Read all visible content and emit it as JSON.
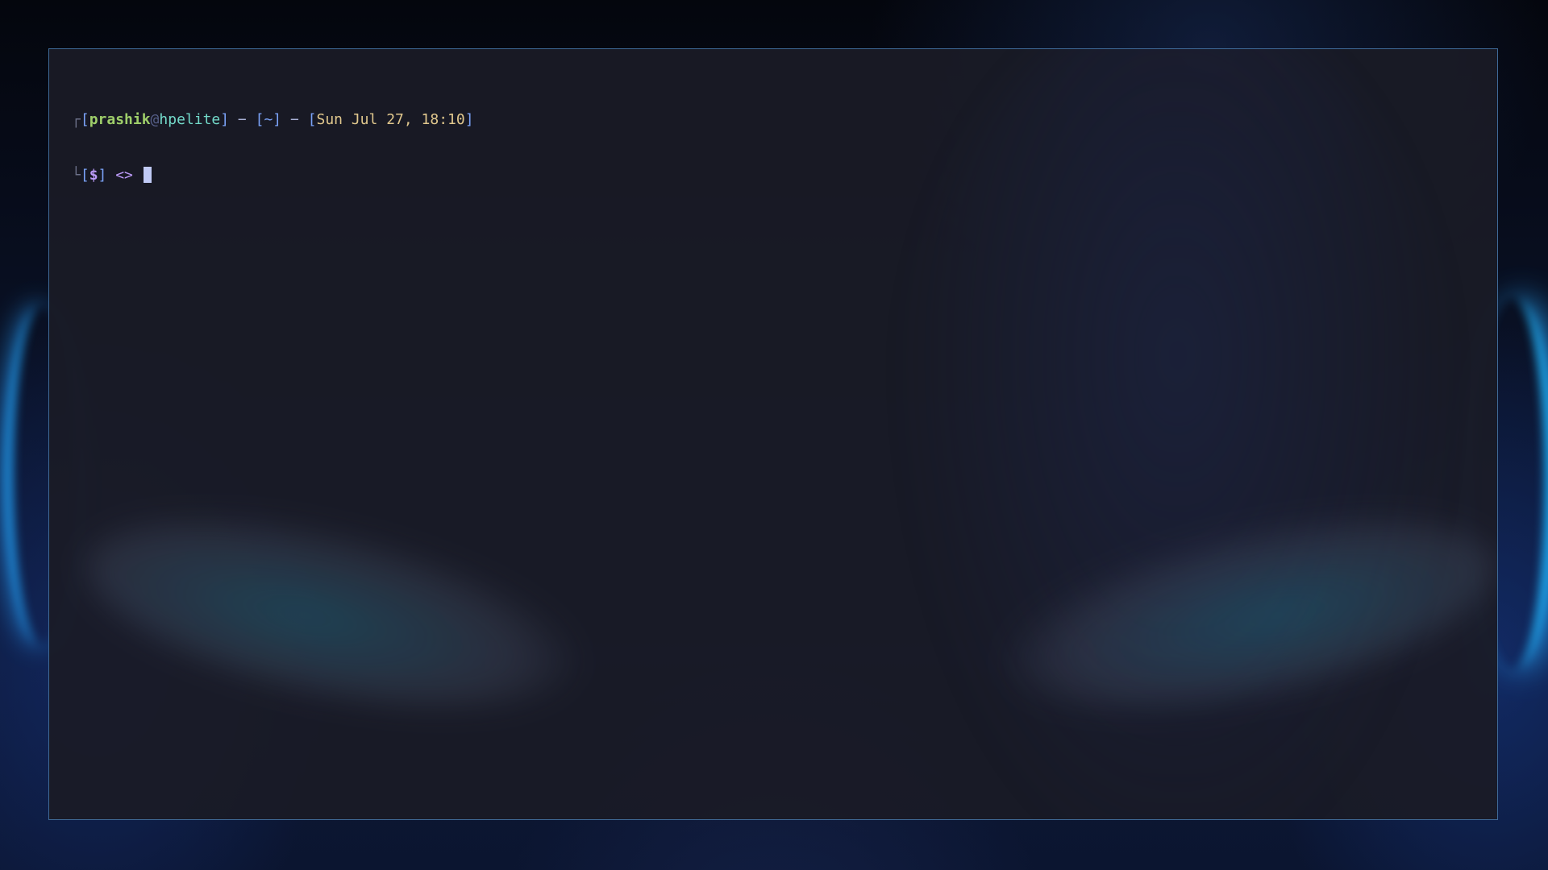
{
  "terminal": {
    "line1": {
      "box_top": "┌",
      "open1": "[",
      "user": "prashik",
      "at": "@",
      "host": "hpelite",
      "close1": "]",
      "sep1": " − ",
      "open2": "[",
      "cwd": "~",
      "close2": "]",
      "sep2": " − ",
      "open3": "[",
      "datetime": "Sun Jul 27, 18:10",
      "close3": "]"
    },
    "line2": {
      "box_bottom": "└",
      "open": "[",
      "prompt_symbol": "$",
      "close": "]",
      "arrows": " <> "
    }
  },
  "colors": {
    "terminal_bg": "#1a1b26",
    "border": "#3f6a98",
    "user": "#9ece6a",
    "host": "#73daca",
    "bracket": "#7aa2f7",
    "datetime": "#e0c78d",
    "prompt_symbol": "#bb9af7",
    "cursor": "#c0caf5",
    "wallpaper_glow": "#22a7ff"
  }
}
